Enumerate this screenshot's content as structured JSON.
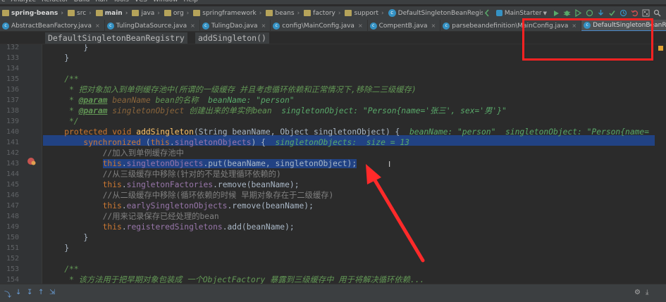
{
  "menu": [
    "e",
    "Analyze",
    "Refactor",
    "Build",
    "Run",
    "Tools",
    "VCS",
    "Window",
    "Help"
  ],
  "navbar": {
    "crumbs": [
      {
        "label": "spring-beans",
        "icon": "folder-icon",
        "bold": true
      },
      {
        "label": "src",
        "icon": "folder-icon"
      },
      {
        "label": "main",
        "icon": "folder-icon",
        "bold": true
      },
      {
        "label": "java",
        "icon": "folder-icon"
      },
      {
        "label": "org",
        "icon": "folder-icon"
      },
      {
        "label": "springframework",
        "icon": "folder-icon"
      },
      {
        "label": "beans",
        "icon": "folder-icon"
      },
      {
        "label": "factory",
        "icon": "folder-icon"
      },
      {
        "label": "support",
        "icon": "folder-icon"
      },
      {
        "label": "DefaultSingletonBeanRegistry",
        "icon": "class-icon"
      }
    ],
    "run_config": "MainStarter"
  },
  "tabs": [
    {
      "label": "AbstractBeanFactory.java",
      "icon": "class-icon",
      "active": false
    },
    {
      "label": "TulingDataSource.java",
      "icon": "class-icon",
      "active": false
    },
    {
      "label": "TulingDao.java",
      "icon": "class-icon",
      "active": false
    },
    {
      "label": "config\\MainConfig.java",
      "icon": "class-icon",
      "active": false
    },
    {
      "label": "CompentB.java",
      "icon": "class-icon",
      "active": false
    },
    {
      "label": "parsebeandefinition\\MainConfig.java",
      "icon": "class-icon",
      "active": false
    },
    {
      "label": "DefaultSingletonBeanRegistry.java",
      "icon": "class-icon",
      "active": true
    }
  ],
  "tabs_overflow": "»",
  "editor_breadcrumb": {
    "class_name": "DefaultSingletonBeanRegistry",
    "method_name": "addSingleton()"
  },
  "code": {
    "line_numbers": [
      "132",
      "133",
      "134",
      "135",
      "136",
      "137",
      "138",
      "139",
      "140",
      "141",
      "142",
      "143",
      "144",
      "145",
      "146",
      "147",
      "148",
      "149",
      "150",
      "151",
      "152",
      "153",
      "154"
    ],
    "l132": "        }",
    "l133": "    }",
    "l135": "    /**",
    "l136": "     * 把对象加入到单例缓存池中(所谓的一级缓存 并且考虑循环依赖和正常情况下,移除二三级缓存)",
    "l137_tag": "@param",
    "l137_param": "beanName",
    "l137_text": " bean的名称  ",
    "l137_hint": "beanName: \"person\"",
    "l138_tag": "@param",
    "l138_param": "singletonObject",
    "l138_text": " 创建出来的单实例bean  ",
    "l138_hint": "singletonObject: \"Person{name='张三', sex='男'}\"",
    "l139": "     */",
    "l140_kw1": "protected",
    "l140_kw2": "void",
    "l140_method": "addSingleton",
    "l140_sig": "(String beanName, Object singletonObject) {  ",
    "l140_hint": "beanName: \"person\"  singletonObject: \"Person{name=",
    "l141_kw": "synchronized",
    "l141_this": "this",
    "l141_field": "singletonObjects",
    "l141_hint": "singletonObjects:  size = 13",
    "l142_cmt": "//加入到单例缓存池中",
    "l143_this": "this",
    "l143_field": "singletonObjects",
    "l143_rest": ".put(beanName, singletonObject);",
    "l144_cmt": "//从三级缓存中移除(针对的不是处理循环依赖的)",
    "l145_this": "this",
    "l145_field": "singletonFactories",
    "l145_rest": ".remove(beanName);",
    "l146_cmt": "//从二级缓存中移除(循环依赖的时候 早期对象存在于二级缓存)",
    "l147_this": "this",
    "l147_field": "earlySingletonObjects",
    "l147_rest": ".remove(beanName);",
    "l148_cmt": "//用来记录保存已经处理的bean",
    "l149_this": "this",
    "l149_field": "registeredSingletons",
    "l149_rest": ".add(beanName);",
    "l150": "        }",
    "l151": "    }",
    "l153": "    /**",
    "l154": "     * 该方法用于把早期对象包装成 一个ObjectFactory 暴露到三级缓存中 用于将解决循环依赖..."
  },
  "colors": {
    "background": "#2b2b2b",
    "selection": "#214283",
    "annotation_red": "#ff2222",
    "keyword": "#cc7832",
    "field": "#9876aa",
    "method": "#ffc66d"
  }
}
